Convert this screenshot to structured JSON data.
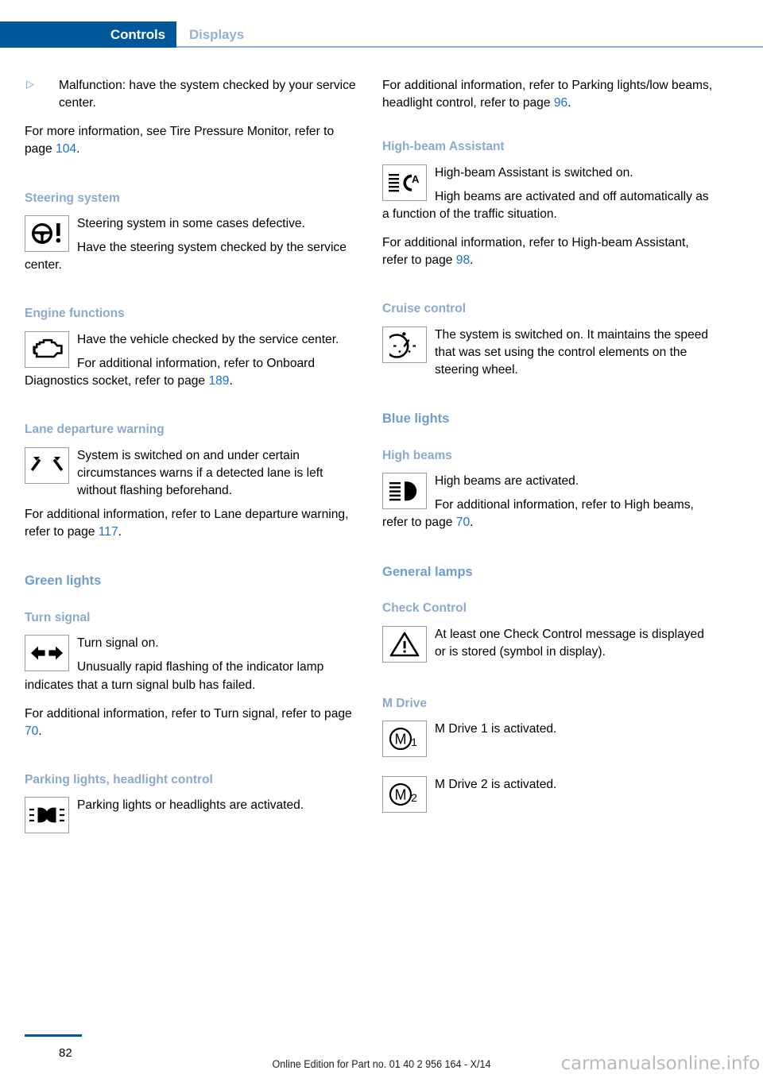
{
  "header": {
    "active_tab": "Controls",
    "inactive_tab": "Displays",
    "accent_color": "#00579a",
    "inactive_color": "#93b2d5"
  },
  "left_column": {
    "bullet_item": {
      "marker": "triangle-right-bullet",
      "text": "Malfunction: have the system checked by your service center."
    },
    "tpms_note": {
      "before": "For more information, see Tire Pressure Moni­tor, refer to page ",
      "page": "104",
      "after": "."
    },
    "steering": {
      "heading": "Steering system",
      "icon": "steering-wheel-warning-icon",
      "line1": "Steering system in some cases defec­tive.",
      "line2": "Have the steering system checked by the service center."
    },
    "engine": {
      "heading": "Engine functions",
      "icon": "check-engine-icon",
      "line1": "Have the vehicle checked by the serv­ice center.",
      "ref_before": "For additional information, refer to On­board Diagnostics socket, refer to page ",
      "ref_page": "189",
      "ref_after": "."
    },
    "lane_departure": {
      "heading": "Lane departure warning",
      "icon": "lane-departure-warning-icon",
      "line1": "System is switched on and under cer­tain circumstances warns if a detected lane is left without flashing beforehand.",
      "ref_before": "For additional information, refer to Lane depar­ture warning, refer to page ",
      "ref_page": "117",
      "ref_after": "."
    },
    "green_lights": {
      "heading": "Green lights"
    },
    "turn_signal": {
      "heading": "Turn signal",
      "icon": "turn-signal-arrows-icon",
      "line1": "Turn signal on.",
      "line2": "Unusually rapid flashing of the indicator lamp indicates that a turn signal bulb has failed.",
      "ref_before": "For additional information, refer to Turn signal, refer to page ",
      "ref_page": "70",
      "ref_after": "."
    },
    "parking_lights": {
      "heading": "Parking lights, headlight control",
      "icon": "parking-lights-icon",
      "line1": "Parking lights or headlights are acti­vated."
    }
  },
  "right_column": {
    "parking_ref": {
      "before": "For additional information, refer to Parking lights/low beams, headlight control, refer to page ",
      "page": "96",
      "after": "."
    },
    "high_beam_assistant": {
      "heading": "High-beam Assistant",
      "icon": "high-beam-assistant-icon",
      "line1": "High-beam Assistant is switched on.",
      "line2": "High beams are activated and off auto­matically as a function of the traffic sit­uation.",
      "ref_before": "For additional information, refer to High-beam Assistant, refer to page ",
      "ref_page": "98",
      "ref_after": "."
    },
    "cruise_control": {
      "heading": "Cruise control",
      "icon": "cruise-control-speedometer-icon",
      "line1": "The system is switched on. It maintains the speed that was set using the con­trol elements on the steering wheel."
    },
    "blue_lights": {
      "heading": "Blue lights"
    },
    "high_beams": {
      "heading": "High beams",
      "icon": "high-beam-icon",
      "line1": "High beams are activated.",
      "ref_before": "For additional information, refer to High beams, refer to page ",
      "ref_page": "70",
      "ref_after": "."
    },
    "general_lamps": {
      "heading": "General lamps"
    },
    "check_control": {
      "heading": "Check Control",
      "icon": "warning-triangle-icon",
      "line1": "At least one Check Control message is displayed or is stored (symbol in dis­play)."
    },
    "m_drive": {
      "heading": "M Drive",
      "item1_icon": "m-drive-1-icon",
      "item1_text": "M Drive 1 is activated.",
      "item2_icon": "m-drive-2-icon",
      "item2_text": "M Drive 2 is activated."
    }
  },
  "footer": {
    "page_number": "82",
    "edition": "Online Edition for Part no. 01 40 2 956 164 - X/14",
    "watermark": "carmanualsonline.info"
  }
}
